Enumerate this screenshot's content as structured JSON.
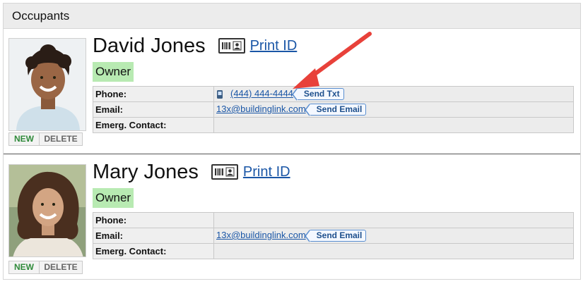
{
  "panel": {
    "title": "Occupants"
  },
  "occupants": [
    {
      "name": "David Jones",
      "role": "Owner",
      "print_id_label": "Print ID",
      "photo_actions": {
        "new": "NEW",
        "delete": "DELETE"
      },
      "fields": {
        "phone_label": "Phone:",
        "phone_value": "(444) 444-4444",
        "send_txt_label": "Send Txt",
        "email_label": "Email:",
        "email_value": "13x@buildinglink.com",
        "send_email_label": "Send Email",
        "emerg_label": "Emerg. Contact:",
        "emerg_value": ""
      }
    },
    {
      "name": "Mary Jones",
      "role": "Owner",
      "print_id_label": "Print ID",
      "photo_actions": {
        "new": "NEW",
        "delete": "DELETE"
      },
      "fields": {
        "phone_label": "Phone:",
        "phone_value": "",
        "email_label": "Email:",
        "email_value": "13x@buildinglink.com",
        "send_email_label": "Send Email",
        "emerg_label": "Emerg. Contact:",
        "emerg_value": ""
      }
    }
  ],
  "colors": {
    "link": "#1a56a6",
    "owner_badge": "#b8eab2",
    "annotation_arrow": "#e8413a",
    "new_button_text": "#2f8a3a"
  },
  "icons": [
    "id-card-icon",
    "mobile-phone-icon",
    "annotation-arrow"
  ]
}
